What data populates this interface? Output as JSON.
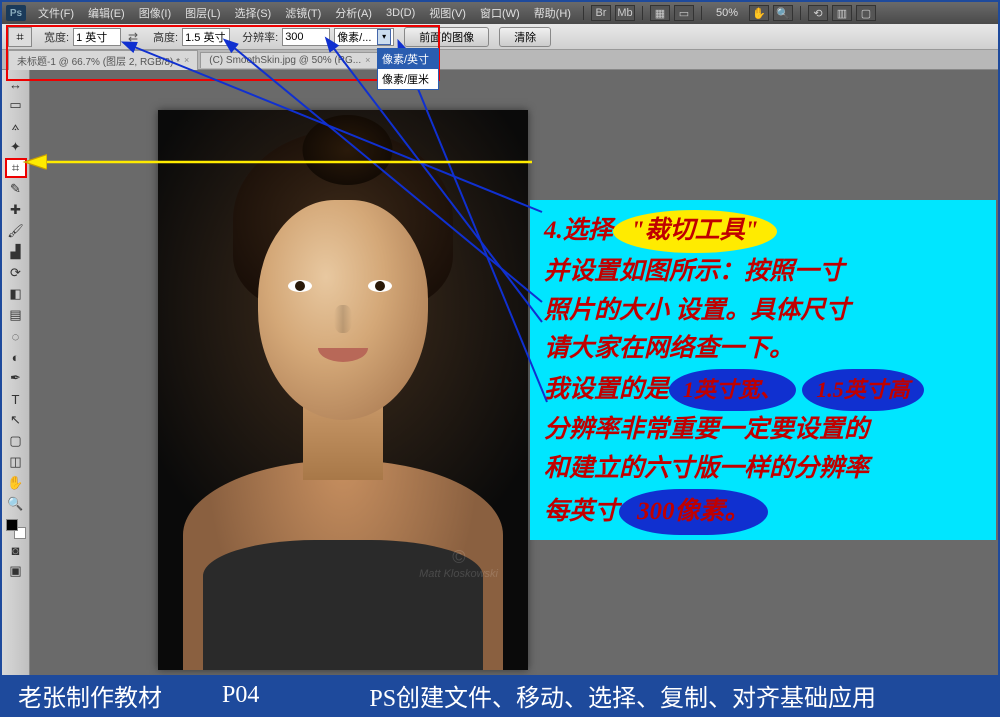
{
  "app": {
    "logo": "Ps"
  },
  "menu": {
    "items": [
      "文件(F)",
      "编辑(E)",
      "图像(I)",
      "图层(L)",
      "选择(S)",
      "滤镜(T)",
      "分析(A)",
      "3D(D)",
      "视图(V)",
      "窗口(W)",
      "帮助(H)"
    ],
    "zoom": "50%"
  },
  "options": {
    "width_label": "宽度:",
    "width_value": "1 英寸",
    "height_label": "高度:",
    "height_value": "1.5 英寸",
    "res_label": "分辨率:",
    "res_value": "300",
    "unit_display": "像素/...",
    "dd_items": [
      "像素/英寸",
      "像素/厘米"
    ],
    "btn_front": "前面的图像",
    "btn_clear": "清除"
  },
  "tabs": [
    {
      "label": "未标题-1 @ 66.7% (图层 2, RGB/8) *"
    },
    {
      "label": "(C) SmoothSkin.jpg @ 50% (RG..."
    }
  ],
  "tools": {
    "names": [
      "move",
      "marquee",
      "lasso",
      "wand",
      "crop",
      "eyedropper",
      "healing",
      "brush",
      "stamp",
      "history",
      "eraser",
      "gradient",
      "blur",
      "dodge",
      "pen",
      "type",
      "path",
      "shape",
      "3d",
      "hand",
      "zoom"
    ],
    "glyphs": [
      "↔",
      "▭",
      "⟑",
      "✦",
      "⌗",
      "✎",
      "✚",
      "🖌",
      "▟",
      "⟳",
      "◧",
      "▤",
      "◌",
      "◐",
      "✒",
      "T",
      "↖",
      "▢",
      "◫",
      "✋",
      "🔍"
    ]
  },
  "watermark": {
    "c": "©",
    "name": "Matt Kloskowski"
  },
  "annotation": {
    "l1a": "4.选择",
    "l1b": "\"裁切工具\"",
    "l2": "并设置如图所示：按照一寸",
    "l3": "照片的大小 设置。具体尺寸",
    "l4": "请大家在网络查一下。",
    "l5a": "我设置的是",
    "l5b": "1英寸宽、",
    "l5c": "1.5英寸高",
    "l6": "分辨率非常重要一定要设置的",
    "l7": "和建立的六寸版一样的分辨率",
    "l8a": "每英寸",
    "l8b": "300像素。"
  },
  "footer": {
    "author": "老张制作教材",
    "page": "P04",
    "title": "PS创建文件、移动、选择、复制、对齐基础应用"
  }
}
